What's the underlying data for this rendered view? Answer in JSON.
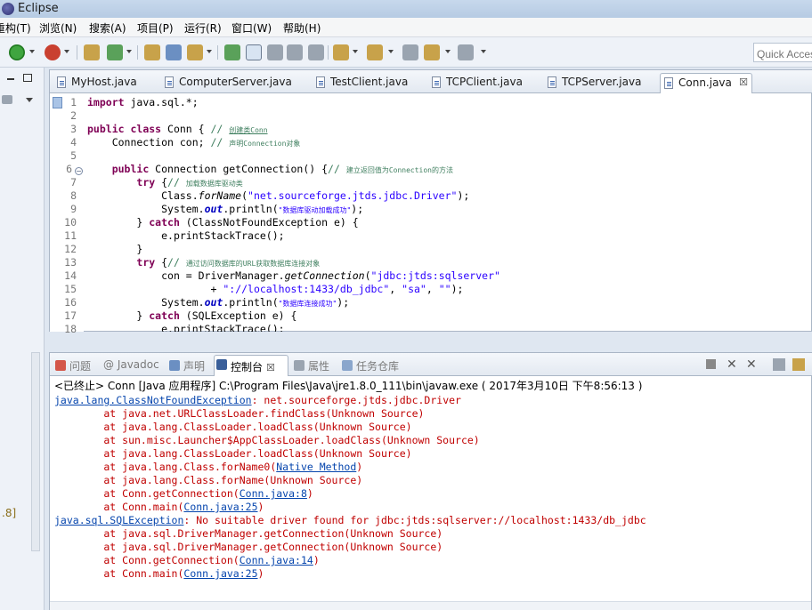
{
  "window": {
    "title": "Eclipse"
  },
  "menu": [
    "重构(T)",
    "浏览(N)",
    "搜索(A)",
    "项目(P)",
    "运行(R)",
    "窗口(W)",
    "帮助(H)"
  ],
  "toolbar": {
    "quick_access_placeholder": "Quick Access"
  },
  "left": {
    "partial_text": ".8]"
  },
  "editor": {
    "tabs": [
      {
        "label": "MyHost.java",
        "active": false
      },
      {
        "label": "ComputerServer.java",
        "active": false
      },
      {
        "label": "TestClient.java",
        "active": false
      },
      {
        "label": "TCPClient.java",
        "active": false
      },
      {
        "label": "TCPServer.java",
        "active": false
      },
      {
        "label": "Conn.java",
        "active": true
      }
    ],
    "close_glyph": "☒",
    "line_numbers": [
      "1",
      "2",
      "3",
      "4",
      "5",
      "6",
      "7",
      "8",
      "9",
      "10",
      "11",
      "12",
      "13",
      "14",
      "15",
      "16",
      "17",
      "18"
    ],
    "code": {
      "l1_kw": "import",
      "l1_rest": " java.sql.*;",
      "l3_kw1": "public",
      "l3_kw2": "class",
      "l3_rest": " Conn { ",
      "l3_cm": "// ",
      "l3_cm_cn": "创建类Conn",
      "l4_rest": "    Connection con; ",
      "l4_cm": "// ",
      "l4_cm_cn": "声明Connection对象",
      "l6_kw": "public",
      "l6_rest": " Connection getConnection() {",
      "l6_cm": "// ",
      "l6_cm_cn": "建立返回值为Connection的方法",
      "l7_kw": "try",
      "l7_rest": " {",
      "l7_cm": "// ",
      "l7_cm_cn": "加载数据库驱动类",
      "l8_a": "Class.",
      "l8_m": "forName",
      "l8_b": "(",
      "l8_str": "\"net.sourceforge.jtds.jdbc.Driver\"",
      "l8_c": ");",
      "l9_a": "System.",
      "l9_st": "out",
      "l9_b": ".println(",
      "l9_str": "\"数据库驱动加载成功\"",
      "l9_c": ");",
      "l10_a": "} ",
      "l10_kw": "catch",
      "l10_rest": " (ClassNotFoundException e) {",
      "l11": "e.printStackTrace();",
      "l12": "}",
      "l13_kw": "try",
      "l13_rest": " {",
      "l13_cm": "// ",
      "l13_cm_cn": "通过访问数据库的URL获取数据库连接对象",
      "l14_a": "con = DriverManager.",
      "l14_m": "getConnection",
      "l14_b": "(",
      "l14_str": "\"jdbc:jtds:sqlserver\"",
      "l15_a": "+ ",
      "l15_str1": "\"://localhost:1433/db_jdbc\"",
      "l15_b": ", ",
      "l15_str2": "\"sa\"",
      "l15_c": ", ",
      "l15_str3": "\"\"",
      "l15_d": ");",
      "l16_a": "System.",
      "l16_st": "out",
      "l16_b": ".println(",
      "l16_str": "\"数据库连接成功\"",
      "l16_c": ");",
      "l17_a": "} ",
      "l17_kw": "catch",
      "l17_rest": " (SQLException e) {",
      "l18": "e.printStackTrace();"
    }
  },
  "panel": {
    "tabs": [
      {
        "label": "问题",
        "active": false
      },
      {
        "label": "@ Javadoc",
        "active": false
      },
      {
        "label": "声明",
        "active": false
      },
      {
        "label": "控制台",
        "active": true
      },
      {
        "label": "属性",
        "active": false
      },
      {
        "label": "任务仓库",
        "active": false
      }
    ],
    "process_line": "<已终止> Conn [Java 应用程序] C:\\Program Files\\Java\\jre1.8.0_111\\bin\\javaw.exe ( 2017年3月10日 下午8:56:13 )",
    "console": {
      "e1_link": "java.lang.ClassNotFoundException",
      "e1_msg": ": net.sourceforge.jtds.jdbc.Driver",
      "s1": "        at java.net.URLClassLoader.findClass(Unknown Source)",
      "s2": "        at java.lang.ClassLoader.loadClass(Unknown Source)",
      "s3": "        at sun.misc.Launcher$AppClassLoader.loadClass(Unknown Source)",
      "s4": "        at java.lang.ClassLoader.loadClass(Unknown Source)",
      "s5_a": "        at java.lang.Class.forName0(",
      "s5_link": "Native Method",
      "s5_b": ")",
      "s6": "        at java.lang.Class.forName(Unknown Source)",
      "s7_a": "        at Conn.getConnection(",
      "s7_link": "Conn.java:8",
      "s7_b": ")",
      "s8_a": "        at Conn.main(",
      "s8_link": "Conn.java:25",
      "s8_b": ")",
      "e2_link": "java.sql.SQLException",
      "e2_msg": ": No suitable driver found for jdbc:jtds:sqlserver://localhost:1433/db_jdbc",
      "t1": "        at java.sql.DriverManager.getConnection(Unknown Source)",
      "t2": "        at java.sql.DriverManager.getConnection(Unknown Source)",
      "t3_a": "        at Conn.getConnection(",
      "t3_link": "Conn.java:14",
      "t3_b": ")",
      "t4_a": "        at Conn.main(",
      "t4_link": "Conn.java:25",
      "t4_b": ")"
    }
  }
}
